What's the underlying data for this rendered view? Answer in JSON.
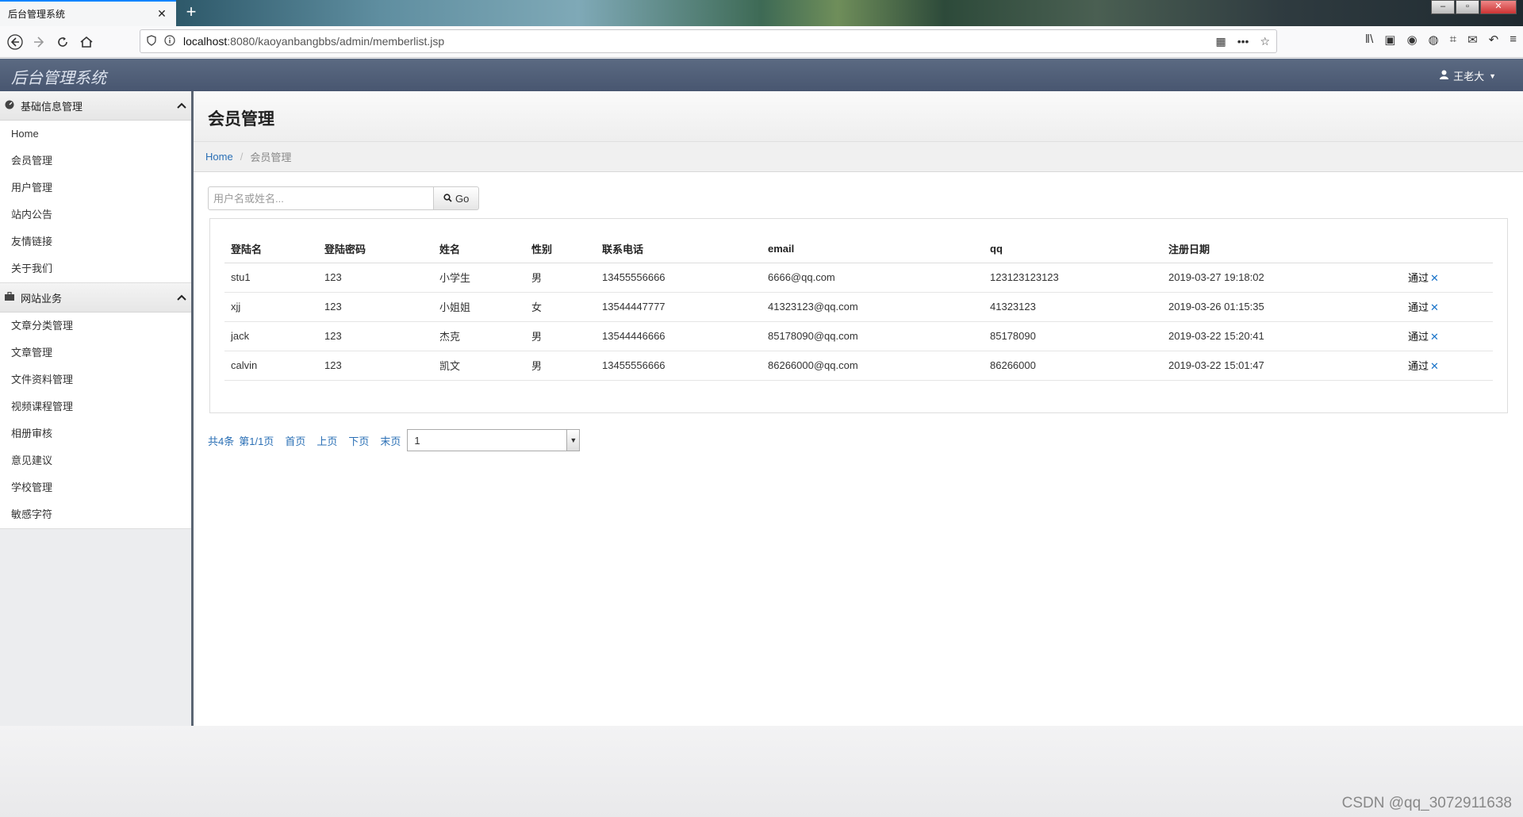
{
  "browser": {
    "tab_title": "后台管理系统",
    "tab_close": "✕",
    "new_tab": "+",
    "url_host": "localhost",
    "url_rest": ":8080/kaoyanbangbbs/admin/memberlist.jsp"
  },
  "app": {
    "brand": "后台管理系统",
    "user": "王老大"
  },
  "sidebar": {
    "sections": [
      {
        "label": "基础信息管理",
        "items": [
          "Home",
          "会员管理",
          "用户管理",
          "站内公告",
          "友情链接",
          "关于我们"
        ]
      },
      {
        "label": "网站业务",
        "items": [
          "文章分类管理",
          "文章管理",
          "文件资料管理",
          "视频课程管理",
          "相册审核",
          "意见建议",
          "学校管理",
          "敏感字符"
        ]
      }
    ]
  },
  "main": {
    "title": "会员管理",
    "breadcrumb": {
      "home": "Home",
      "sep": "/",
      "current": "会员管理"
    },
    "search": {
      "placeholder": "用户名或姓名...",
      "button": "Go"
    },
    "table": {
      "headers": [
        "登陆名",
        "登陆密码",
        "姓名",
        "性别",
        "联系电话",
        "email",
        "qq",
        "注册日期",
        ""
      ],
      "rows": [
        {
          "login": "stu1",
          "password": "123",
          "name": "小学生",
          "gender": "男",
          "phone": "13455556666",
          "email": "6666@qq.com",
          "qq": "123123123123",
          "date": "2019-03-27 19:18:02",
          "action": "通过"
        },
        {
          "login": "xjj",
          "password": "123",
          "name": "小姐姐",
          "gender": "女",
          "phone": "13544447777",
          "email": "41323123@qq.com",
          "qq": "41323123",
          "date": "2019-03-26 01:15:35",
          "action": "通过"
        },
        {
          "login": "jack",
          "password": "123",
          "name": "杰克",
          "gender": "男",
          "phone": "13544446666",
          "email": "85178090@qq.com",
          "qq": "85178090",
          "date": "2019-03-22 15:20:41",
          "action": "通过"
        },
        {
          "login": "calvin",
          "password": "123",
          "name": "凯文",
          "gender": "男",
          "phone": "13455556666",
          "email": "86266000@qq.com",
          "qq": "86266000",
          "date": "2019-03-22 15:01:47",
          "action": "通过"
        }
      ]
    },
    "pager": {
      "total": "共4条",
      "page": "第1/1页",
      "first": "首页",
      "prev": "上页",
      "next": "下页",
      "last": "末页",
      "selected": "1"
    }
  },
  "watermark": "CSDN @qq_3072911638",
  "colors": {
    "header": "#485670",
    "link": "#2a6fb5",
    "delete": "#1a74c9"
  }
}
